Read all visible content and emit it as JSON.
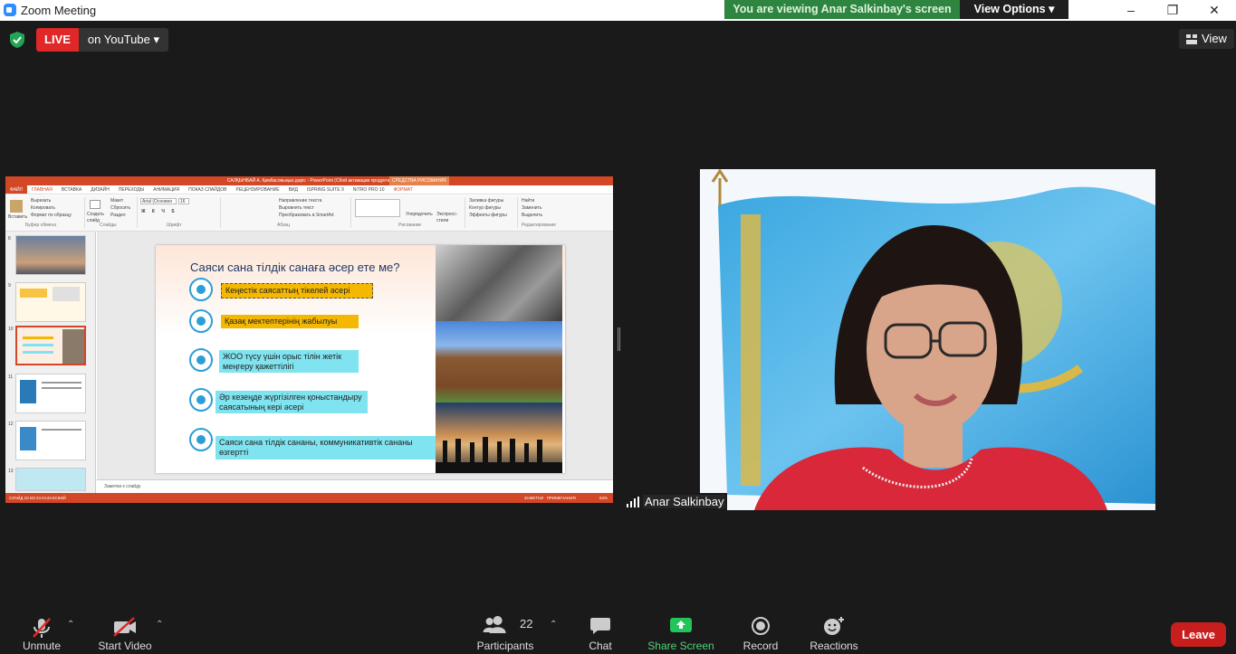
{
  "window": {
    "title": "Zoom Meeting"
  },
  "banner": {
    "message": "You are viewing Anar  Salkinbay's screen",
    "view_options": "View Options"
  },
  "stream": {
    "live_label": "LIVE",
    "target": "on YouTube"
  },
  "view_button": {
    "label": "View"
  },
  "shared_screen": {
    "ppt_title": "САЛҚЫНБАЙ А. Қимбасовыңыз дәріс - PowerPoint (Сбой активации продукта)",
    "drawing_tools": "СРЕДСТВА РИСОВАНИЯ",
    "tabs": [
      "ФАЙЛ",
      "ГЛАВНАЯ",
      "ВСТАВКА",
      "ДИЗАЙН",
      "ПЕРЕХОДЫ",
      "АНИМАЦИЯ",
      "ПОКАЗ СЛАЙДОВ",
      "РЕЦЕНЗИРОВАНИЕ",
      "ВИД",
      "ISPRING SUITE 9",
      "NITRO PRO 10",
      "ФОРМАТ"
    ],
    "ribbon": {
      "clipboard": [
        "Вставить",
        "Вырезать",
        "Копировать",
        "Формат по образцу"
      ],
      "clipboard_group": "Буфер обмена",
      "slides": [
        "Создать слайд",
        "Макет",
        "Сбросить",
        "Раздел"
      ],
      "slides_group": "Слайды",
      "font_name": "Arial (Основно",
      "font_size": "16",
      "font_group": "Шрифт",
      "paragraph": [
        "Направление текста",
        "Выровнять текст",
        "Преобразовать в SmartArt"
      ],
      "paragraph_group": "Абзац",
      "arrange": [
        "Упорядочить",
        "Экспресс-стили"
      ],
      "drawing": [
        "Заливка фигуры",
        "Контур фигуры",
        "Эффекты фигуры"
      ],
      "drawing_group": "Рисование",
      "editing": [
        "Найти",
        "Заменить",
        "Выделить"
      ],
      "editing_group": "Редактирование"
    },
    "thumb_numbers": [
      "8",
      "9",
      "10",
      "11",
      "12",
      "13"
    ],
    "slide": {
      "title": "Саяси сана тілдік санаға әсер ете ме?",
      "bullets": [
        "Кеңестік саясаттың тікелей әсері",
        "Қазақ мектептерінің жабылуы",
        "ЖОО түсу үшін орыс тілін жетік меңгеру   қажеттілігі",
        "Әр кезеңде жүргізілген қоныстандыру саясатының кері әсері",
        "Саяси сана тілдік сананы, коммуникативтік сананы өзгертті"
      ]
    },
    "notes": "Заметки к слайду",
    "status": {
      "left": "СЛАЙД 10 ИЗ 24     КАЗАХСКИЙ",
      "notes_btn": "ЗАМЕТКИ",
      "comments_btn": "ПРИМЕЧАНИЯ",
      "zoom": "63%"
    }
  },
  "participant": {
    "name": "Anar  Salkinbay"
  },
  "toolbar": {
    "unmute": "Unmute",
    "start_video": "Start Video",
    "participants": "Participants",
    "participants_count": "22",
    "chat": "Chat",
    "share_screen": "Share Screen",
    "record": "Record",
    "reactions": "Reactions",
    "leave": "Leave"
  }
}
